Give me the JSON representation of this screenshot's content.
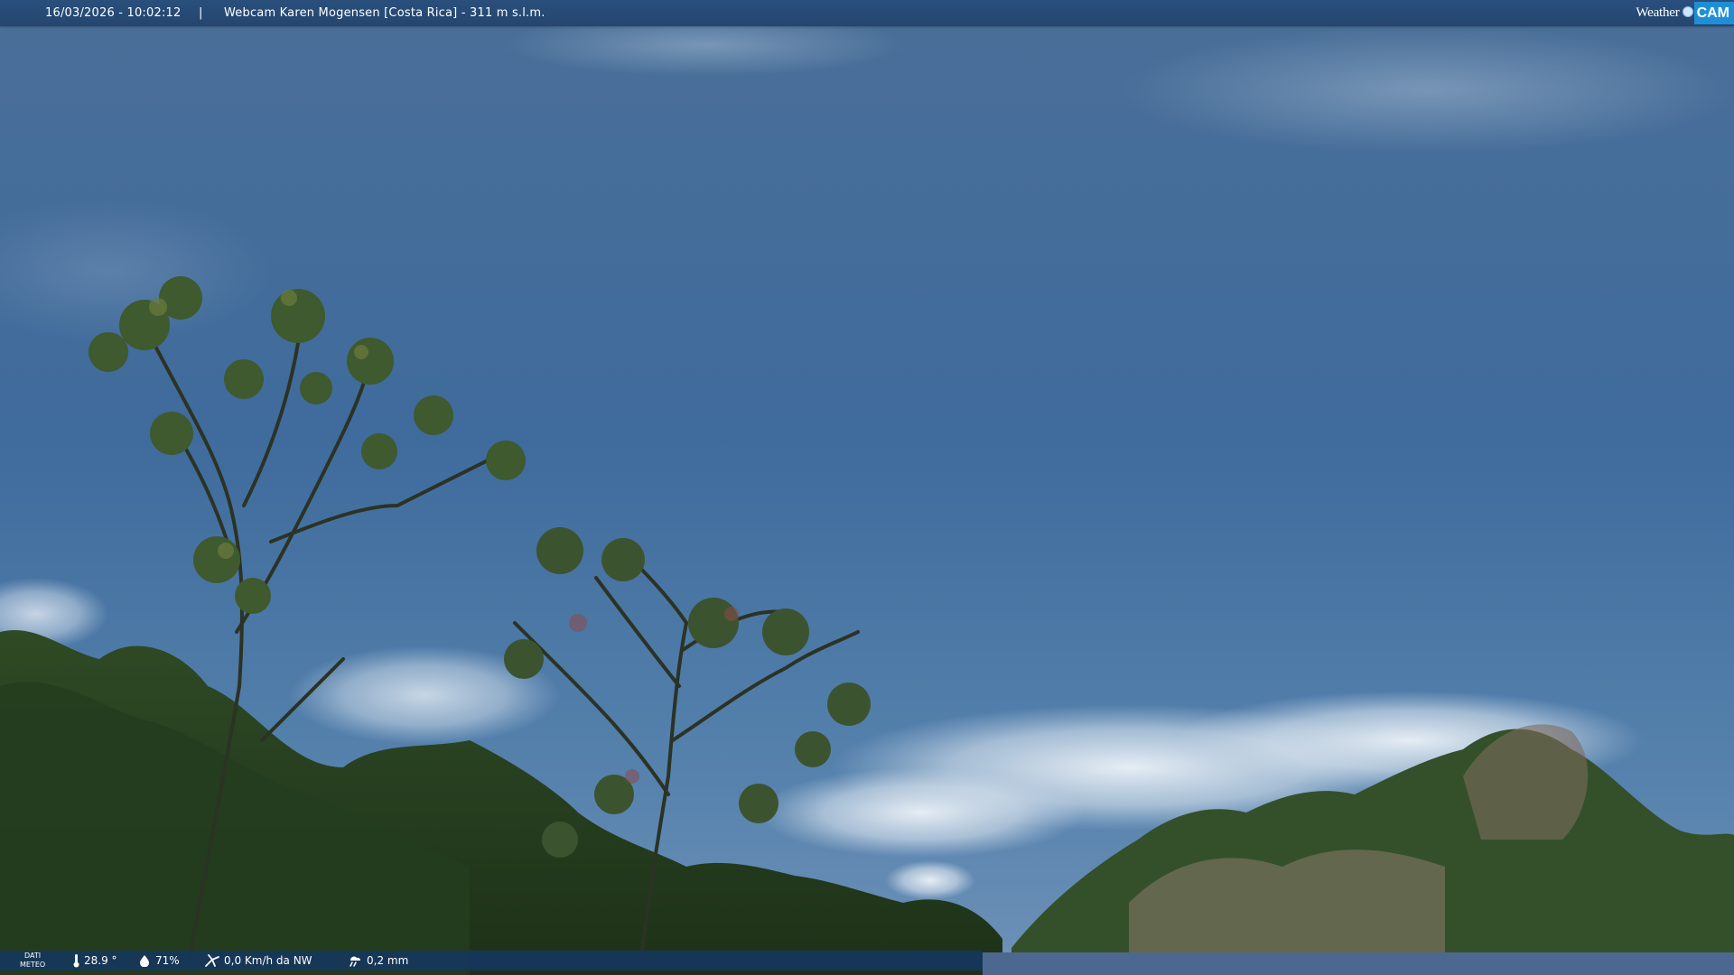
{
  "header": {
    "datetime": "16/03/2026 - 10:02:12",
    "separator": "|",
    "title": "Webcam Karen Mogensen [Costa Rica]  - 311 m s.l.m.",
    "logo": {
      "word": "Weather",
      "badge": "CAM"
    }
  },
  "meteo": {
    "label_line1": "DATI",
    "label_line2": "METEO",
    "temperature": "28.9 °",
    "humidity": "71%",
    "wind": "0,0 Km/h da NW",
    "rain": "0,2 mm",
    "icons": [
      "thermometer-icon",
      "humidity-drop-icon",
      "wind-icon",
      "rain-cloud-icon"
    ]
  },
  "colors": {
    "bar": "#24466f",
    "logo_badge": "#1e8fd6",
    "sky": "#3f6a9a"
  }
}
